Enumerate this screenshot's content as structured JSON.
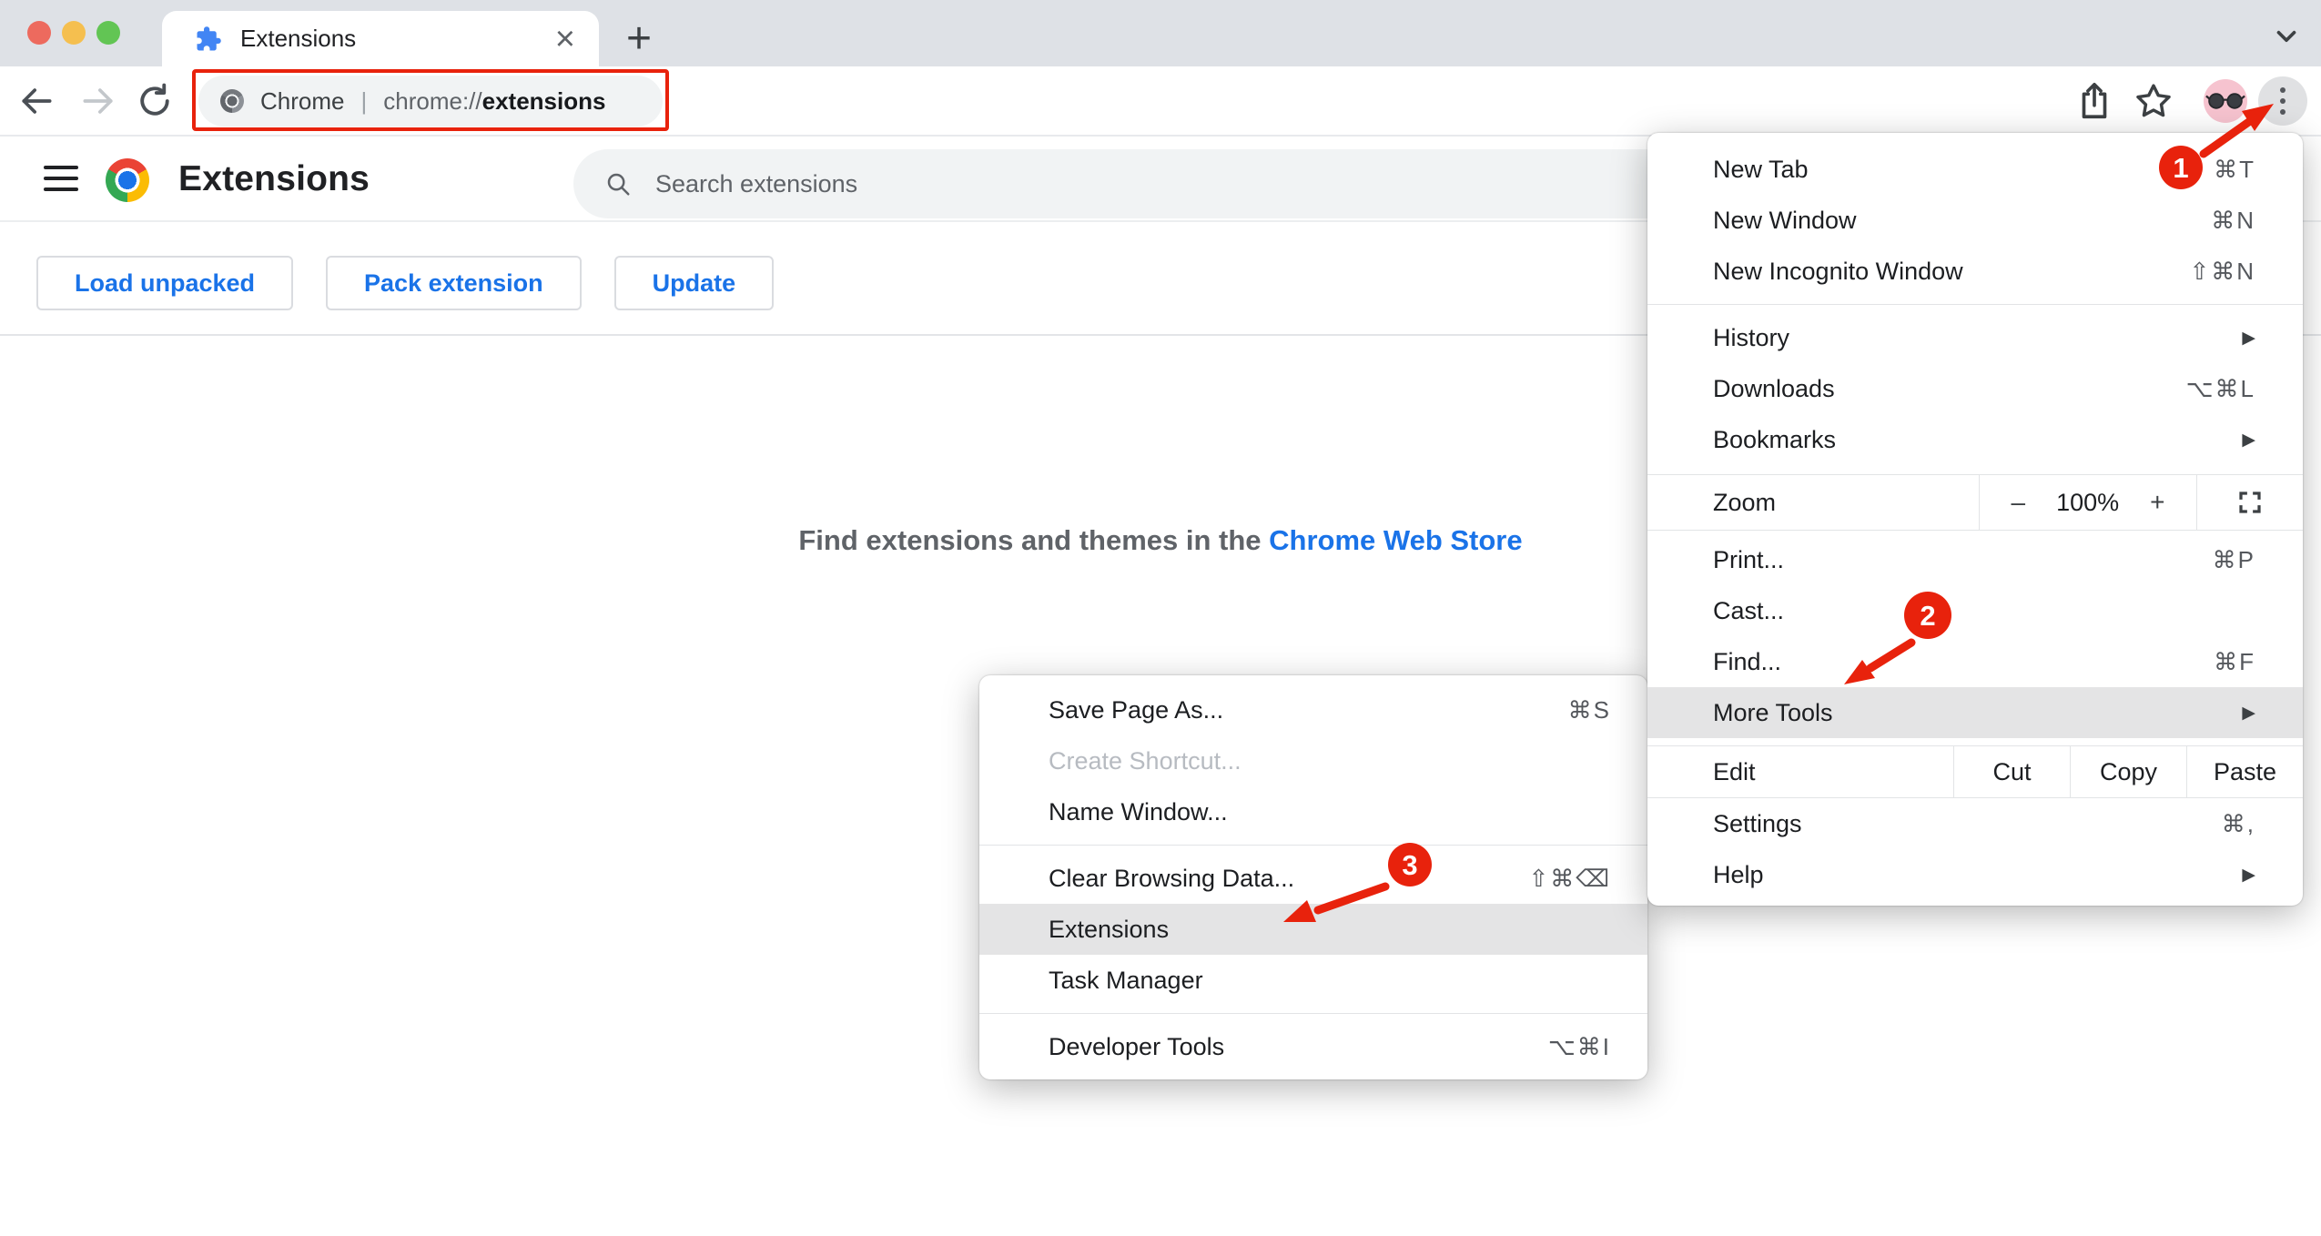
{
  "colors": {
    "annotation_red": "#E8220C",
    "accent_blue": "#1A73E8",
    "favicon_blue": "#4285F4",
    "avatar_pink": "#F6C3CF",
    "tabstrip_gray": "#DEE1E6",
    "omnibox_gray": "#F1F3F4",
    "menu_highlight_gray": "#E4E4E5"
  },
  "window": {
    "tab_title": "Extensions",
    "new_tab_button": "+",
    "close_tab": "×"
  },
  "toolbar": {
    "url_chrome_label": "Chrome",
    "url_separator": "|",
    "url_scheme": "chrome://",
    "url_host": "extensions"
  },
  "extensions_page": {
    "title": "Extensions",
    "search_placeholder": "Search extensions",
    "buttons": {
      "load_unpacked": "Load unpacked",
      "pack_extension": "Pack extension",
      "update": "Update"
    },
    "empty_state": {
      "text": "Find extensions and themes in the ",
      "link": "Chrome Web Store"
    }
  },
  "menu": {
    "items": [
      {
        "label": "New Tab",
        "shortcut": "⌘T"
      },
      {
        "label": "New Window",
        "shortcut": "⌘N"
      },
      {
        "label": "New Incognito Window",
        "shortcut": "⇧⌘N"
      },
      {
        "label": "History"
      },
      {
        "label": "Downloads",
        "shortcut": "⌥⌘L"
      },
      {
        "label": "Bookmarks"
      },
      {
        "label": "Zoom",
        "zoom_out": "–",
        "zoom_value": "100%",
        "zoom_in": "+"
      },
      {
        "label": "Print...",
        "shortcut": "⌘P"
      },
      {
        "label": "Cast..."
      },
      {
        "label": "Find...",
        "shortcut": "⌘F"
      },
      {
        "label": "More Tools"
      },
      {
        "label": "Edit",
        "cut": "Cut",
        "copy": "Copy",
        "paste": "Paste"
      },
      {
        "label": "Settings",
        "shortcut": "⌘,"
      },
      {
        "label": "Help"
      }
    ]
  },
  "submenu": {
    "items": [
      {
        "label": "Save Page As...",
        "shortcut": "⌘S"
      },
      {
        "label": "Create Shortcut..."
      },
      {
        "label": "Name Window..."
      },
      {
        "label": "Clear Browsing Data...",
        "shortcut": "⇧⌘⌫"
      },
      {
        "label": "Extensions"
      },
      {
        "label": "Task Manager"
      },
      {
        "label": "Developer Tools",
        "shortcut": "⌥⌘I"
      }
    ]
  },
  "annotations": {
    "step1": "1",
    "step2": "2",
    "step3": "3"
  },
  "icons": {
    "caret": "▶"
  }
}
